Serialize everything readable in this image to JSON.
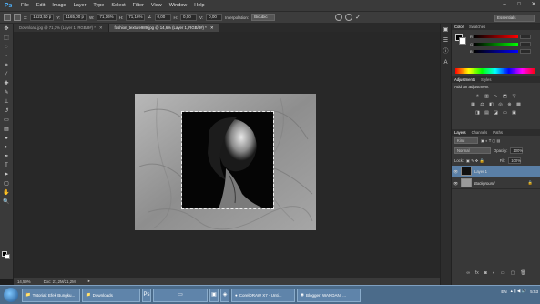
{
  "app": {
    "logo": "Ps"
  },
  "menu": [
    "File",
    "Edit",
    "Image",
    "Layer",
    "Type",
    "Select",
    "Filter",
    "View",
    "Window",
    "Help"
  ],
  "window_controls": {
    "minimize": "–",
    "maximize": "□",
    "close": "✕"
  },
  "options": {
    "x_label": "X:",
    "x_value": "1623,50 p",
    "y_label": "Y:",
    "y_value": "1165,00 p",
    "w_label": "W:",
    "w_value": "71,16%",
    "h_label": "H:",
    "h_value": "71,16%",
    "angle_label": "∠",
    "angle_value": "0,00",
    "hskew_label": "H:",
    "hskew_value": "0,00",
    "vskew_label": "V:",
    "vskew_value": "0,00",
    "interp_label": "Interpolation:",
    "interp_value": "Bicubic",
    "workspace": "Essentials"
  },
  "tabs": [
    {
      "label": "Download.jpg @ 71,3% (Layer 1, RGB/8#) *",
      "close": "✕",
      "active": false
    },
    {
      "label": "fashion_texture989.jpg @ 14,6% (Layer 1, RGB/8#) *",
      "close": "✕",
      "active": true
    }
  ],
  "status": {
    "zoom": "14,59%",
    "doc": "Doc: 21,2M/21,2M",
    "arrow": "▸"
  },
  "colors": {
    "accent": "#5a7fa6",
    "app_bg": "#282828",
    "panel_bg": "#383838"
  },
  "color_panel": {
    "tabs": [
      "Color",
      "Swatches"
    ],
    "r_label": "R",
    "g_label": "G",
    "b_label": "B"
  },
  "adjustments": {
    "tabs": [
      "Adjustments",
      "Styles"
    ],
    "title": "Add an adjustment"
  },
  "layers": {
    "tabs": [
      "Layers",
      "Channels",
      "Paths"
    ],
    "kind": "Kind",
    "blend_mode": "Normal",
    "opacity_label": "Opacity:",
    "opacity_value": "100%",
    "lock_label": "Lock:",
    "fill_label": "Fill:",
    "fill_value": "100%",
    "items": [
      {
        "name": "Layer 1",
        "selected": true,
        "lock": ""
      },
      {
        "name": "Background",
        "selected": false,
        "lock": "🔒"
      }
    ]
  },
  "taskbar": {
    "items": [
      {
        "label": "Tutorial: Efek Bungku...",
        "icon": "folder"
      },
      {
        "label": "Downloads",
        "icon": "folder"
      },
      {
        "label": "",
        "icon": "ps"
      },
      {
        "label": "",
        "icon": "app"
      },
      {
        "label": "",
        "icon": "app"
      },
      {
        "label": "CorelDRAW X7 - Unti...",
        "icon": "corel"
      },
      {
        "label": "Blogger: WANDANI ...",
        "icon": "chrome"
      }
    ],
    "tray": {
      "lang": "EN",
      "time": "5:53"
    }
  }
}
